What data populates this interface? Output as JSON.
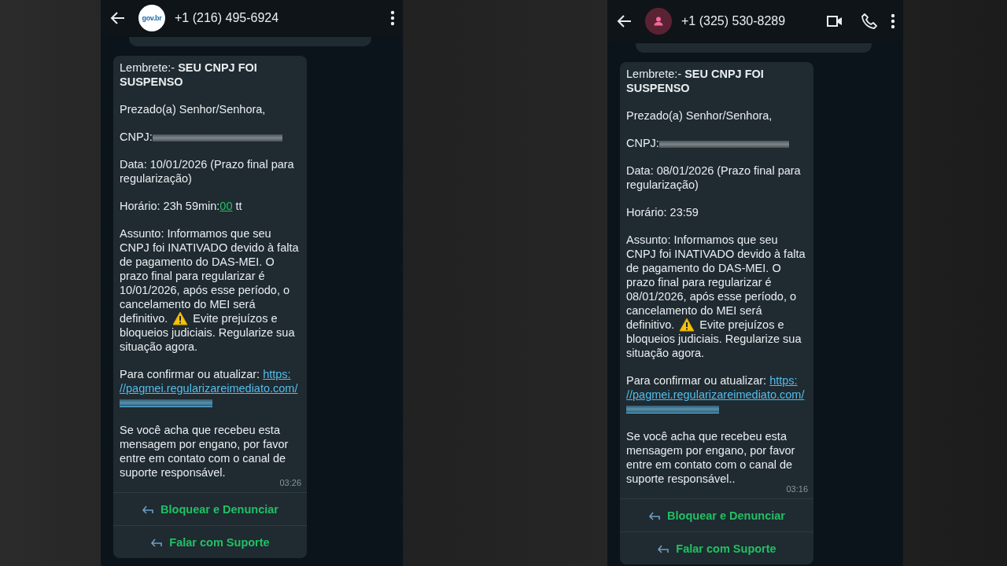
{
  "phones": [
    {
      "contact": {
        "name": "+1 (216) 495-6924",
        "avatar": {
          "kind": "logo",
          "text": "gov.br"
        }
      },
      "header_actions": [
        {
          "kind": "menu"
        }
      ],
      "message": {
        "paragraphs": [
          [
            {
              "kind": "text",
              "text": "Lembrete:- **SEU CNPJ FOI SUSPENSO**"
            }
          ],
          [
            {
              "kind": "text",
              "text": "Prezado(a) Senhor/Senhora,"
            }
          ],
          [
            {
              "kind": "text",
              "text": "CNPJ:"
            },
            {
              "kind": "redacted"
            }
          ],
          [
            {
              "kind": "text",
              "text": "Data: 10/01/2026 (Prazo final para regularização)"
            }
          ],
          [
            {
              "kind": "text",
              "text": "Horário: 23h 59min:"
            },
            {
              "kind": "detected",
              "text": "00"
            },
            {
              "kind": "text",
              "text": " tt"
            }
          ],
          [
            {
              "kind": "text",
              "text": "Assunto: Informamos que seu CNPJ foi INATIVADO devido à falta de pagamento do DAS-MEI. O prazo final para regularizar é 10/01/2026, após esse período, o cancelamento do MEI será definitivo. "
            },
            {
              "kind": "warning"
            },
            {
              "kind": "text",
              "text": " Evite prejuízos e bloqueios judiciais. Regularize sua situação agora."
            }
          ],
          [
            {
              "kind": "text",
              "text": "Para confirmar ou atualizar: "
            },
            {
              "kind": "link",
              "text": "https:"
            },
            {
              "kind": "link",
              "text": "//pagmei.regularizareimediato"
            },
            {
              "kind": "link",
              "text": ".com/"
            },
            {
              "kind": "redacted_link"
            }
          ],
          [
            {
              "kind": "text",
              "text": "Se você acha que recebeu esta mensagem por engano, por favor entre em contato com o canal de suporte responsável."
            }
          ]
        ],
        "time": "03:26"
      },
      "buttons": [
        {
          "label": "Bloquear e Denunciar"
        },
        {
          "label": "Falar com Suporte"
        }
      ]
    },
    {
      "contact": {
        "name": "+1 (325) 530-8289",
        "avatar": {
          "kind": "person"
        }
      },
      "header_actions": [
        {
          "kind": "video"
        },
        {
          "kind": "call"
        },
        {
          "kind": "menu"
        }
      ],
      "message": {
        "paragraphs": [
          [
            {
              "kind": "text",
              "text": "Lembrete:- **SEU CNPJ FOI SUSPENSO**"
            }
          ],
          [
            {
              "kind": "text",
              "text": "Prezado(a) Senhor/Senhora,"
            }
          ],
          [
            {
              "kind": "text",
              "text": "CNPJ:"
            },
            {
              "kind": "redacted"
            }
          ],
          [
            {
              "kind": "text",
              "text": "Data: 08/01/2026 (Prazo final para regularização)"
            }
          ],
          [
            {
              "kind": "text",
              "text": "Horário: 23:59"
            }
          ],
          [
            {
              "kind": "text",
              "text": "Assunto: Informamos que seu CNPJ foi INATIVADO devido à falta de pagamento do DAS-MEI. O prazo final para regularizar é 08/01/2026, após esse período, o cancelamento do MEI será definitivo. "
            },
            {
              "kind": "warning"
            },
            {
              "kind": "text",
              "text": " Evite prejuízos e bloqueios judiciais. Regularize sua situação agora."
            }
          ],
          [
            {
              "kind": "text",
              "text": "Para confirmar ou atualizar: "
            },
            {
              "kind": "link",
              "text": "https:"
            },
            {
              "kind": "link",
              "text": "//pagmei.regularizareimediato"
            },
            {
              "kind": "link",
              "text": ".com/"
            },
            {
              "kind": "redacted_link"
            }
          ],
          [
            {
              "kind": "text",
              "text": "Se você acha que recebeu esta mensagem por engano, por favor entre em contato com o canal de suporte responsável.."
            }
          ]
        ],
        "time": "03:16"
      },
      "buttons": [
        {
          "label": "Bloquear e Denunciar"
        },
        {
          "label": "Falar com Suporte"
        }
      ]
    }
  ]
}
